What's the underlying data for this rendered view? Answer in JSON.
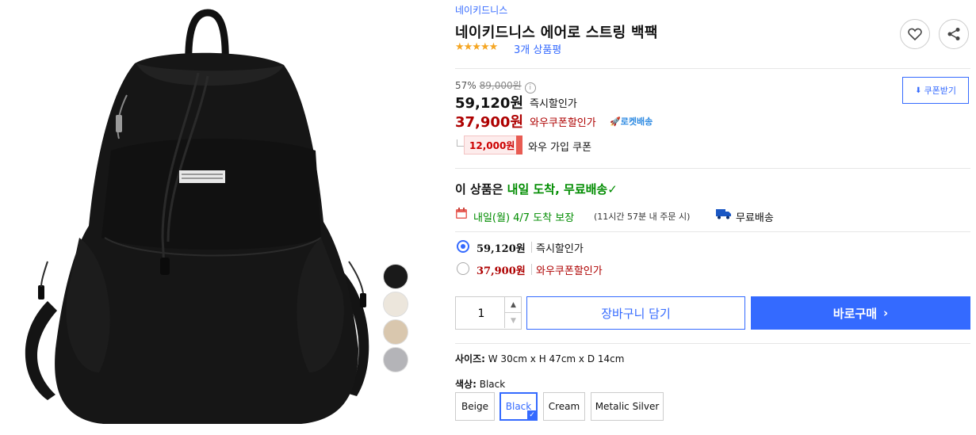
{
  "product": {
    "brand": "네이키드니스",
    "title": "네이키드니스 에어로 스트링 백팩",
    "rating_stars": "★★★★★",
    "rating_value": 4.5,
    "review_count": "3개 상품평"
  },
  "pricing": {
    "discount_rate": "57%",
    "original_price": "89,000원",
    "instant_price": "59,120원",
    "instant_label": "즉시할인가",
    "wow_price": "37,900원",
    "wow_label": "와우쿠폰할인가",
    "rocket_label": "로켓배송",
    "coupon_amount": "12,000원",
    "coupon_text": "와우 가입 쿠폰",
    "coupon_button": "쿠폰받기"
  },
  "delivery": {
    "headline_prefix": "이 상품은",
    "headline_highlight": "내일 도착, 무료배송",
    "date_text": "내일(월) 4/7 도착 보장",
    "date_sub": "(11시간 57분 내 주문 시)",
    "free_shipping": "무료배송"
  },
  "options": [
    {
      "price": "59,120원",
      "label": "즉시할인가",
      "selected": true
    },
    {
      "price": "37,900원",
      "label": "와우쿠폰할인가",
      "selected": false
    }
  ],
  "purchase": {
    "quantity": "1",
    "cart_label": "장바구니 담기",
    "buy_label": "바로구매"
  },
  "specs": {
    "size_label": "사이즈:",
    "size_value": "W 30cm x H 47cm x D 14cm",
    "color_label": "색상:",
    "color_value": "Black"
  },
  "color_options": [
    "Beige",
    "Black",
    "Cream",
    "Metalic Silver"
  ],
  "selected_color": "Black",
  "swatches": [
    {
      "name": "Black",
      "color": "#1a1a1a"
    },
    {
      "name": "Cream",
      "color": "#ece6dc"
    },
    {
      "name": "Beige",
      "color": "#d9c7ae"
    },
    {
      "name": "Metalic Silver",
      "color": "#b4b4b8"
    }
  ],
  "colors": {
    "accent": "#346aff",
    "wow_red": "#ae0000",
    "delivery_green": "#008c00"
  }
}
